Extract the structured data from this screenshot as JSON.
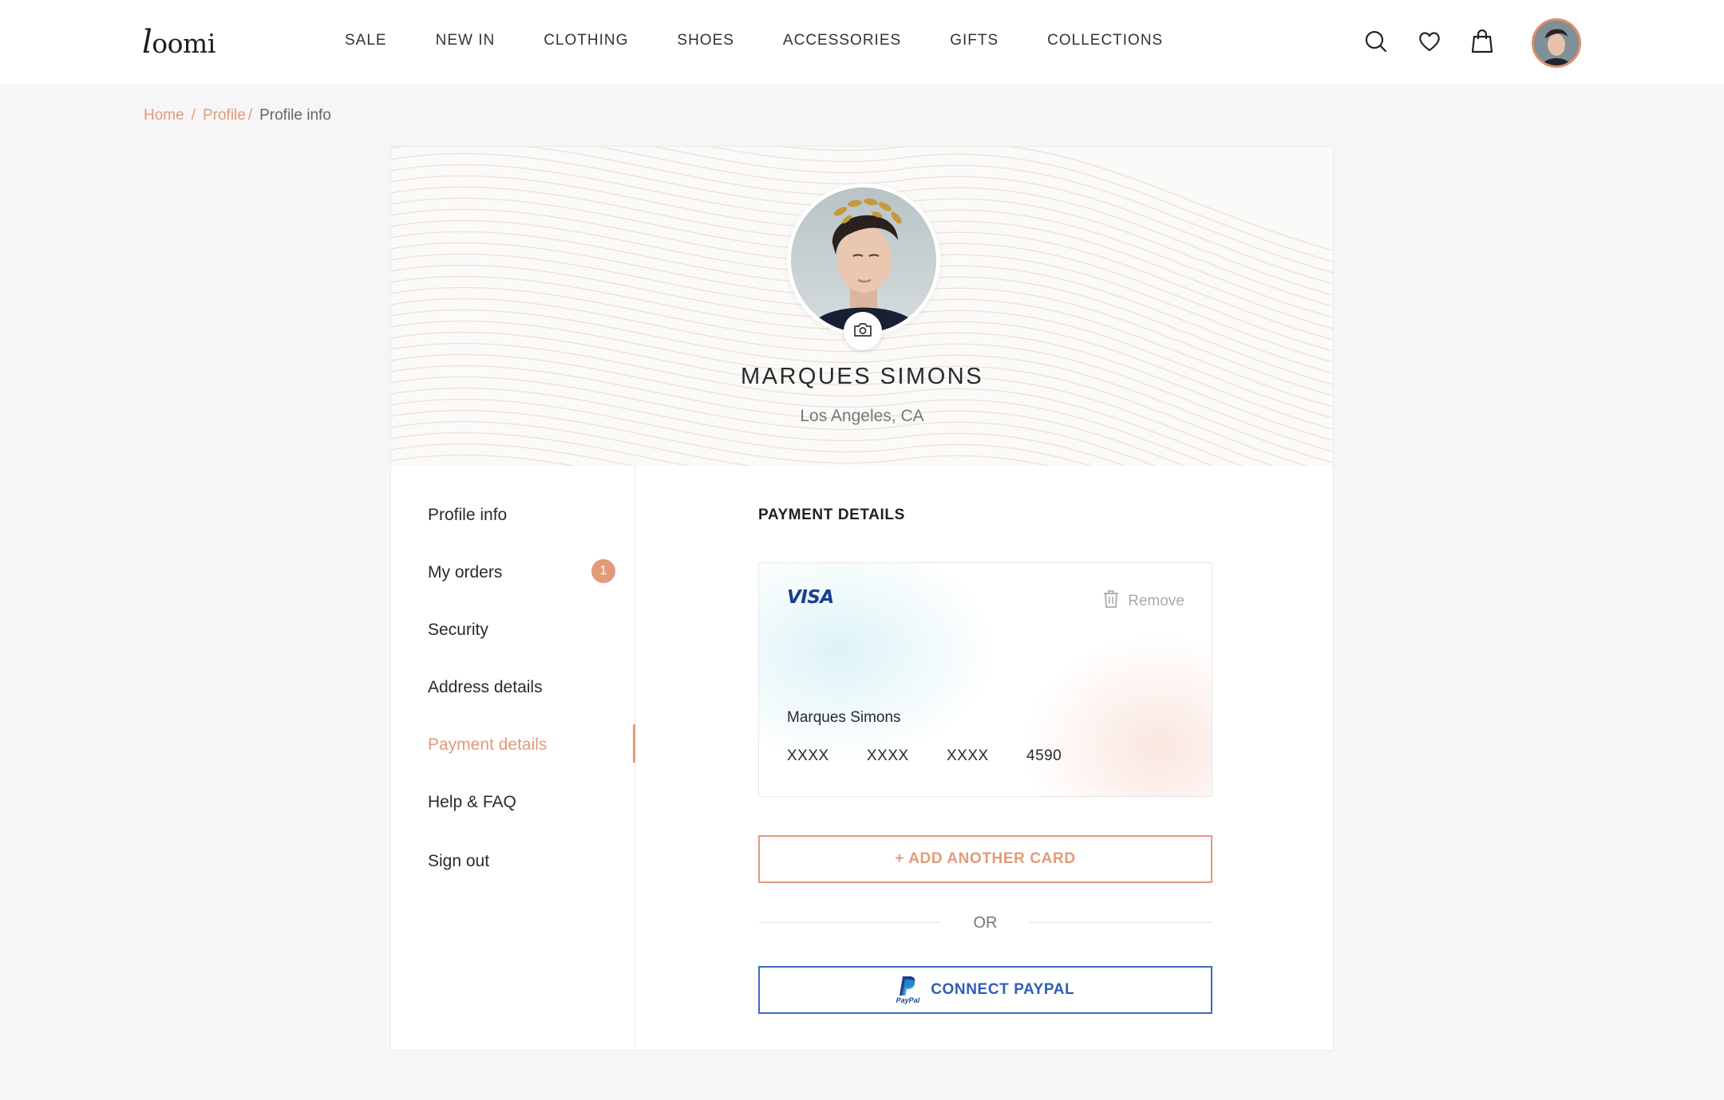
{
  "header": {
    "logo": {
      "first": "l",
      "rest": "oomi"
    },
    "nav": [
      "SALE",
      "NEW IN",
      "CLOTHING",
      "SHOES",
      "ACCESSORIES",
      "GIFTS",
      "COLLECTIONS"
    ],
    "icons": [
      "search-icon",
      "heart-icon",
      "bag-icon"
    ]
  },
  "breadcrumb": {
    "items": [
      "Home",
      "Profile"
    ],
    "current": "Profile info"
  },
  "profile": {
    "name": "MARQUES SIMONS",
    "location": "Los Angeles, CA"
  },
  "sidebar": {
    "items": [
      {
        "label": "Profile info"
      },
      {
        "label": "My orders",
        "badge": "1"
      },
      {
        "label": "Security"
      },
      {
        "label": "Address details"
      },
      {
        "label": "Payment details",
        "active": true
      },
      {
        "label": "Help & FAQ"
      },
      {
        "label": "Sign out"
      }
    ]
  },
  "payment": {
    "title": "PAYMENT DETAILS",
    "card": {
      "brand": "VISA",
      "remove_label": "Remove",
      "holder": "Marques Simons",
      "number_groups": [
        "XXXX",
        "XXXX",
        "XXXX",
        "4590"
      ]
    },
    "add_card_label": "+ ADD ANOTHER CARD",
    "or_label": "OR",
    "paypal_label": "CONNECT PAYPAL",
    "paypal_logo_text": "PayPal"
  },
  "colors": {
    "accent": "#e39a7b",
    "paypal": "#2f5db5",
    "visa": "#1a3e91",
    "background": "#f6f6f6"
  }
}
